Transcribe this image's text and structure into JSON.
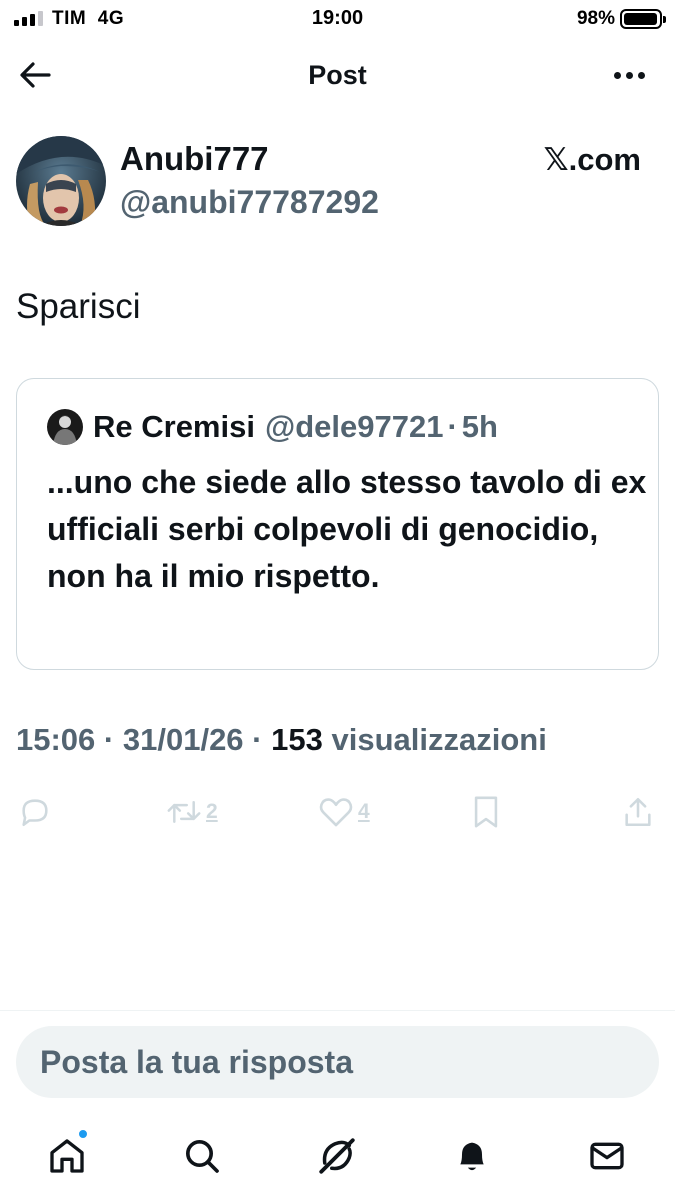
{
  "status_bar": {
    "carrier": "TIM",
    "network": "4G",
    "time": "19:00",
    "battery_percent": "98%",
    "battery_level": 0.98
  },
  "header": {
    "title": "Post",
    "back_icon": "arrow-left-icon",
    "more_icon": "more-horizontal-icon"
  },
  "post": {
    "author": {
      "display_name": "Anubi777",
      "handle": "@anubi77787292"
    },
    "source_label": "𝕏.com",
    "text": "Sparisci",
    "quote": {
      "author_name": "Re Cremisi",
      "author_handle": "@dele97721",
      "separator": "·",
      "age": "5h",
      "text": "...uno che siede allo stesso tavolo di ex ufficiali serbi colpevoli di genocidio, non ha il mio rispetto."
    },
    "meta": {
      "time": "15:06",
      "separator": "·",
      "date": "31/01/26",
      "views_count": "153",
      "views_label": "visualizzazioni"
    },
    "actions": {
      "reply_icon": "reply-icon",
      "repost_icon": "repost-icon",
      "repost_count": "2",
      "like_icon": "heart-icon",
      "like_count": "4",
      "bookmark_icon": "bookmark-icon",
      "share_icon": "share-icon"
    }
  },
  "reply": {
    "placeholder": "Posta la tua risposta"
  },
  "bottom_nav": {
    "items": [
      {
        "icon": "home-icon",
        "has_notification_dot": true
      },
      {
        "icon": "search-icon"
      },
      {
        "icon": "grok-icon"
      },
      {
        "icon": "bell-icon"
      },
      {
        "icon": "mail-icon"
      }
    ]
  },
  "colors": {
    "text_primary": "#0f1419",
    "text_secondary": "#536471",
    "border": "#cfd9de",
    "input_bg": "#eff3f4",
    "accent": "#1d9bf0"
  }
}
